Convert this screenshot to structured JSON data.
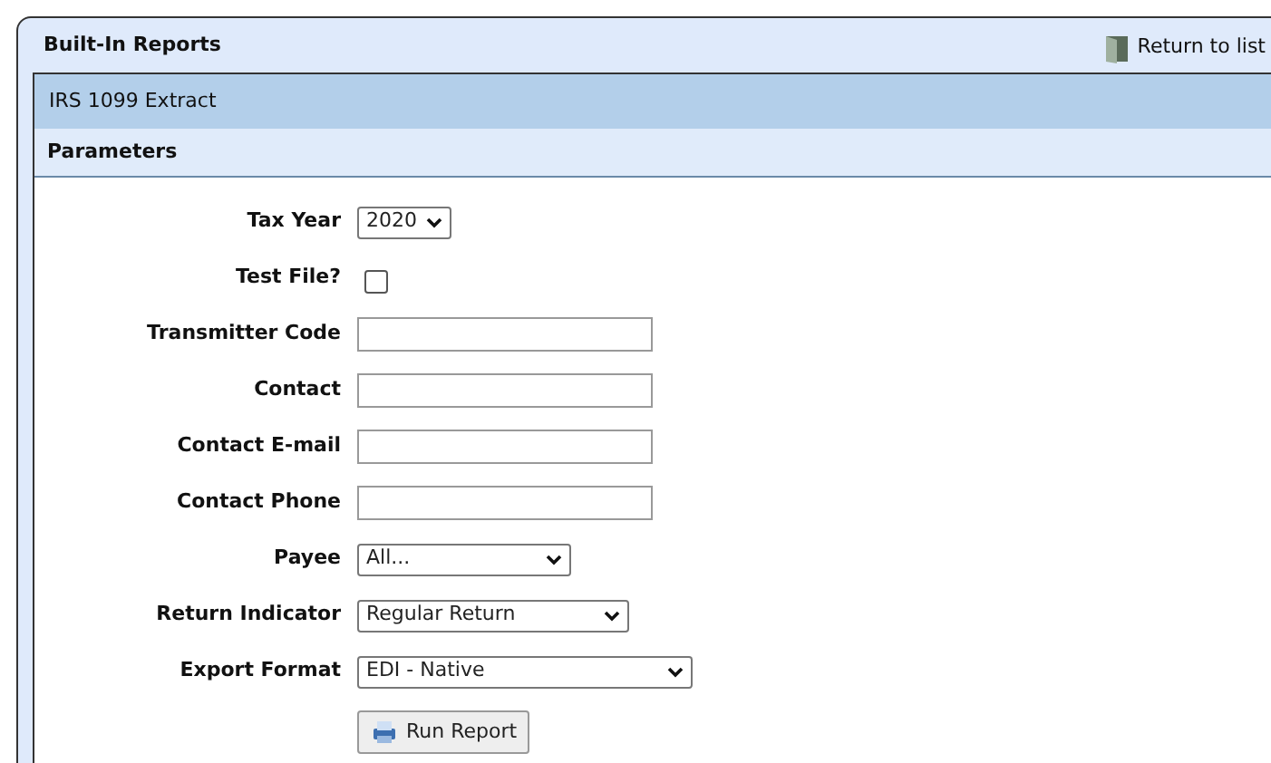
{
  "panel": {
    "title": "Built-In Reports",
    "return_link": "Return to list"
  },
  "report": {
    "title": "IRS 1099 Extract",
    "section": "Parameters"
  },
  "fields": [
    {
      "label": "Tax Year",
      "kind": "select",
      "value": "2020"
    },
    {
      "label": "Test File?",
      "kind": "checkbox",
      "checked": false
    },
    {
      "label": "Transmitter Code",
      "kind": "text"
    },
    {
      "label": "Contact",
      "kind": "text"
    },
    {
      "label": "Contact E-mail",
      "kind": "text"
    },
    {
      "label": "Contact Phone",
      "kind": "text"
    },
    {
      "label": "Payee",
      "kind": "select",
      "value": "All..."
    },
    {
      "label": "Return Indicator",
      "kind": "select",
      "value": "Regular Return"
    },
    {
      "label": "Export Format",
      "kind": "select",
      "value": "EDI - Native"
    }
  ],
  "run_button": "Run Report"
}
